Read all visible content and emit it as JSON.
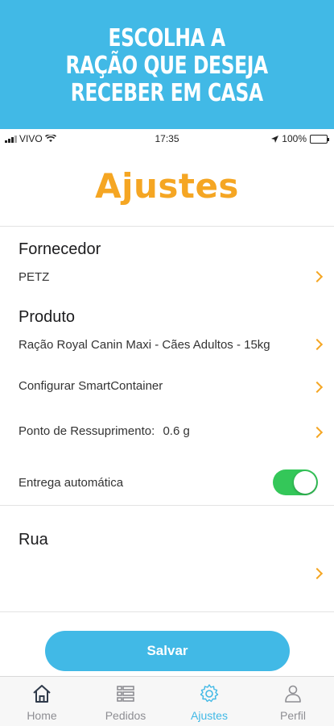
{
  "banner": {
    "lines": [
      "ESCOLHA A",
      "RAÇÃO QUE  DESEJA",
      "RECEBER EM CASA"
    ]
  },
  "statusbar": {
    "carrier": "VIVO",
    "time": "17:35",
    "battery": "100%"
  },
  "page_title": "Ajustes",
  "settings": {
    "supplier": {
      "label": "Fornecedor",
      "value": "PETZ"
    },
    "product": {
      "label": "Produto",
      "value": "Ração Royal Canin Maxi - Cães Adultos - 15kg"
    },
    "configure_label": "Configurar SmartContainer",
    "resupply": {
      "label": "Ponto de Ressuprimento:",
      "value": "0.6 g"
    },
    "auto_delivery": {
      "label": "Entrega automática",
      "enabled": true
    },
    "street": {
      "label": "Rua",
      "value": ""
    }
  },
  "save_label": "Salvar",
  "tabs": [
    {
      "label": "Home",
      "icon": "home-icon",
      "active": false
    },
    {
      "label": "Pedidos",
      "icon": "list-icon",
      "active": false
    },
    {
      "label": "Ajustes",
      "icon": "gear-icon",
      "active": true
    },
    {
      "label": "Perfil",
      "icon": "person-icon",
      "active": false
    }
  ],
  "colors": {
    "brand_blue": "#41b9e6",
    "accent_orange": "#f5a623",
    "toggle_green": "#34c759"
  }
}
